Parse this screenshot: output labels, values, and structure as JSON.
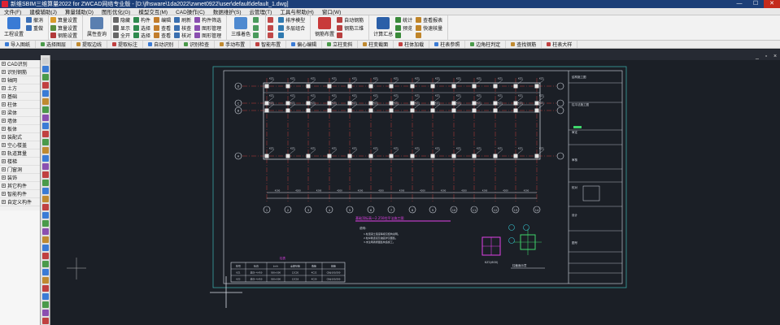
{
  "window": {
    "title": "新维SBIM三维算量2022 for ZWCAD网络专业版 - [D:\\jfhsware\\1da2022\\zwnet0922\\user\\default\\default_1.dwg]",
    "minimize": "—",
    "maximize": "☐",
    "close": "✕"
  },
  "menu": [
    "文件(F)",
    "建模辅助(J)",
    "算量辅助(D)",
    "图形优化(G)",
    "模型交互(M)",
    "CAD操作(C)",
    "数据维护(S)",
    "云管理(T)",
    "工具与帮助(H)",
    "窗口(W)"
  ],
  "ribbon": {
    "groups": [
      {
        "big": [
          {
            "label": "工程设置",
            "color": "#3a7bd5"
          }
        ],
        "small": [
          [
            {
              "label": "撤消",
              "color": "#3b6fb6"
            },
            {
              "label": "重做",
              "color": "#3b6fb6"
            }
          ]
        ]
      },
      {
        "big": [],
        "small": [
          [
            {
              "label": "算量设置",
              "color": "#d99b2b"
            },
            {
              "label": "算量设置",
              "color": "#5a8d3e"
            },
            {
              "label": "钢筋设置",
              "color": "#b23a3a"
            }
          ]
        ]
      },
      {
        "big": [
          {
            "label": "属性查询",
            "color": "#5a7fb0"
          }
        ],
        "small": []
      },
      {
        "big": [],
        "small": [
          [
            {
              "label": "隐藏",
              "color": "#666"
            },
            {
              "label": "显示",
              "color": "#666"
            },
            {
              "label": "全开",
              "color": "#666"
            }
          ],
          [
            {
              "label": "构件",
              "color": "#2f8a4e"
            },
            {
              "label": "选择",
              "color": "#2f8a4e"
            },
            {
              "label": "选择",
              "color": "#2f8a4e"
            }
          ],
          [
            {
              "label": "编辑",
              "color": "#c27d2c"
            },
            {
              "label": "查看",
              "color": "#c27d2c"
            },
            {
              "label": "查看",
              "color": "#c27d2c"
            }
          ],
          [
            {
              "label": "刷新",
              "color": "#3a6fb0"
            },
            {
              "label": "核查",
              "color": "#3a6fb0"
            },
            {
              "label": "核对",
              "color": "#3a6fb0"
            }
          ],
          [
            {
              "label": "构件筛选",
              "color": "#8a4fb0"
            },
            {
              "label": "图形管理",
              "color": "#8a4fb0"
            },
            {
              "label": "图形管理",
              "color": "#8a4fb0"
            }
          ]
        ]
      },
      {
        "big": [
          {
            "label": "三维着色",
            "color": "#4f8ad0"
          }
        ],
        "small": [
          [
            {
              "label": "",
              "color": "#4a9a5c"
            },
            {
              "label": "",
              "color": "#4a9a5c"
            },
            {
              "label": "",
              "color": "#4a9a5c"
            }
          ]
        ]
      },
      {
        "big": [],
        "small": [
          [
            {
              "label": "",
              "color": "#c04848"
            },
            {
              "label": "",
              "color": "#c04848"
            },
            {
              "label": "",
              "color": "#c04848"
            }
          ],
          [
            {
              "label": "排序模型",
              "color": "#2f7ab0"
            },
            {
              "label": "多层组合",
              "color": "#2f7ab0"
            },
            {
              "label": "",
              "color": "#2f7ab0"
            }
          ]
        ]
      },
      {
        "big": [
          {
            "label": "钢筋布置",
            "color": "#c83a3a"
          }
        ],
        "small": [
          [
            {
              "label": "自动钢筋",
              "color": "#b84040"
            },
            {
              "label": "钢筋三维",
              "color": "#b84040"
            },
            {
              "label": "",
              "color": "#b84040"
            }
          ]
        ]
      },
      {
        "big": [
          {
            "label": "计算汇总",
            "color": "#2b5fa8"
          }
        ],
        "small": [
          [
            {
              "label": "统计",
              "color": "#3a8a3a"
            },
            {
              "label": "预览",
              "color": "#3a8a3a"
            },
            {
              "label": "",
              "color": "#3a8a3a"
            }
          ],
          [
            {
              "label": "查看报表",
              "color": "#c0852a"
            },
            {
              "label": "快速核量",
              "color": "#c0852a"
            },
            {
              "label": "",
              "color": "#c0852a"
            }
          ]
        ]
      }
    ]
  },
  "command_bar": [
    "导入图纸",
    "选择图层",
    "提取边线",
    "提取标注",
    "自动识别",
    "识别检查",
    "手动布置",
    "智能布置",
    "偏心编辑",
    "立柱变斜",
    "柱变截面",
    "柱体加载",
    "柱表参照",
    "边角柱判定",
    "查找钢筋",
    "柱表大样"
  ],
  "tree": [
    "CAD识别",
    "识别钢筋",
    "轴网",
    "土方",
    "基础",
    "柱体",
    "梁体",
    "墙体",
    "板体",
    "装配式",
    "空心楼盖",
    "轨道算量",
    "楼梯",
    "门窗洞",
    "装饰",
    "其它构件",
    "智能构件",
    "自定义构件"
  ],
  "vtool_colors": [
    "#d0d0d0",
    "#3a7bd5",
    "#4a9a4a",
    "#c04040",
    "#3a7bd5",
    "#c08a30",
    "#4a9a4a",
    "#8a4fb0",
    "#3a7bd5",
    "#c04040",
    "#4a9a4a",
    "#c08a30",
    "#3a7bd5",
    "#8a4fb0",
    "#c04040",
    "#4a9a4a",
    "#3a7bd5",
    "#c08a30",
    "#c04040",
    "#3a7bd5",
    "#4a9a4a",
    "#8a4fb0",
    "#c08a30",
    "#3a7bd5",
    "#c04040",
    "#4a9a4a",
    "#3a7bd5",
    "#c08a30",
    "#c04040",
    "#3a7bd5",
    "#4a9a4a",
    "#8a4fb0",
    "#c04040"
  ],
  "drawing": {
    "grid_col_labels": [
      "1",
      "2",
      "3",
      "4",
      "5",
      "6",
      "7",
      "8",
      "9",
      "10",
      "11",
      "12",
      "13",
      "14"
    ],
    "grid_row_labels": [
      "D",
      "C",
      "B",
      "A"
    ],
    "dim_values": [
      "4200",
      "4200",
      "4200",
      "4200",
      "4200",
      "4200",
      "4200",
      "4200",
      "4200",
      "4200",
      "4200",
      "4200",
      "4200"
    ],
    "plan_title": "基础顶标高～2.250柱平法施工图",
    "note_title": "说明：",
    "notes": [
      "1.柱混凝土强度等级见结构说明。",
      "2.柱纵筋连接及锚固详见图集。",
      "3.未注明者按图集构造施工。"
    ],
    "detail_left": "KZ1(600)",
    "detail_right": "柱截面示意",
    "table_title": "柱表",
    "table_headers": [
      "柱号",
      "标高",
      "b×h",
      "全部纵筋",
      "角筋",
      "箍筋"
    ],
    "table_rows": [
      [
        "KZ1",
        "基顶~4.450",
        "500×500",
        "12C20",
        "4C22",
        "C8@100/200"
      ],
      [
        "KZ2",
        "基顶~4.450",
        "500×500",
        "12C18",
        "4C20",
        "C8@100/200"
      ]
    ],
    "title_block_lines": [
      "结构施工图",
      "柱平法施工图",
      "审定",
      "审核",
      "校对",
      "设计",
      "图号"
    ]
  },
  "colors": {
    "axis": "#e8463f",
    "line": "#d8dde6",
    "cyan": "#36c6d0",
    "green": "#3fd66b",
    "magenta": "#e040e8",
    "frame": "#3aa6a6"
  }
}
